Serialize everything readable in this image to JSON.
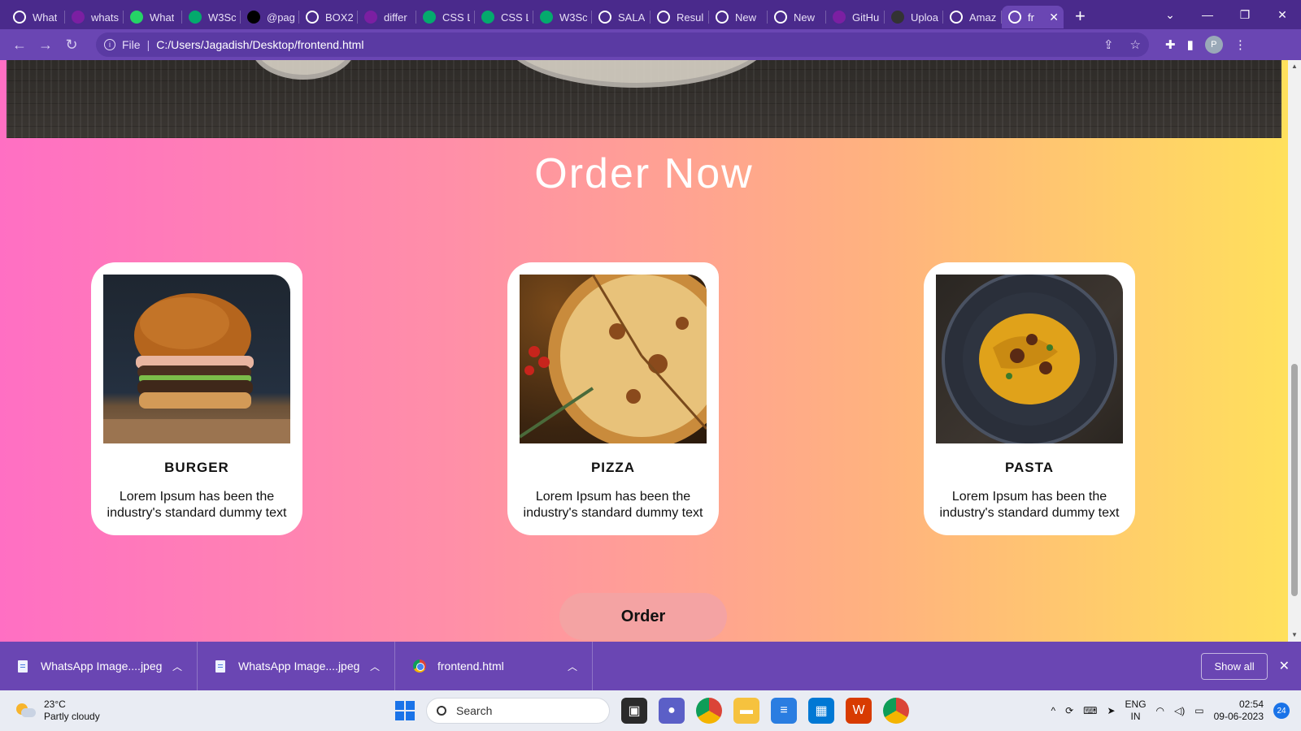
{
  "browser": {
    "tabs": [
      {
        "label": "What",
        "icon": "chrome-icon",
        "color": "#ffffff"
      },
      {
        "label": "whats",
        "icon": "yahoo-icon",
        "color": "#7b1fa2"
      },
      {
        "label": "What",
        "icon": "whatsapp-icon",
        "color": "#25d366"
      },
      {
        "label": "W3Sc",
        "icon": "w3schools-icon",
        "color": "#04aa6d"
      },
      {
        "label": "@pag",
        "icon": "medium-icon",
        "color": "#000000"
      },
      {
        "label": "BOX2",
        "icon": "chrome-icon",
        "color": "#ffffff"
      },
      {
        "label": "differ",
        "icon": "yahoo-icon",
        "color": "#7b1fa2"
      },
      {
        "label": "CSS L",
        "icon": "w3schools-icon",
        "color": "#04aa6d"
      },
      {
        "label": "CSS L",
        "icon": "w3schools-icon",
        "color": "#04aa6d"
      },
      {
        "label": "W3Sc",
        "icon": "w3schools-icon",
        "color": "#04aa6d"
      },
      {
        "label": "SALA",
        "icon": "chrome-icon",
        "color": "#ffffff"
      },
      {
        "label": "Resul",
        "icon": "chrome-icon",
        "color": "#ffffff"
      },
      {
        "label": "New",
        "icon": "chrome-icon",
        "color": "#ffffff"
      },
      {
        "label": "New",
        "icon": "chrome-icon",
        "color": "#ffffff"
      },
      {
        "label": "GitHu",
        "icon": "yahoo-icon",
        "color": "#7b1fa2"
      },
      {
        "label": "Uploa",
        "icon": "github-icon",
        "color": "#333333"
      },
      {
        "label": "Amaz",
        "icon": "amazon-icon",
        "color": "#ffffff"
      },
      {
        "label": "fr",
        "icon": "chrome-icon",
        "color": "#ffffff",
        "active": true
      }
    ],
    "address": {
      "scheme": "File",
      "url": "C:/Users/Jagadish/Desktop/frontend.html"
    },
    "profile_initial": "P"
  },
  "page": {
    "section_title": "Order Now",
    "cards": [
      {
        "name": "BURGER",
        "description": "Lorem Ipsum has been the industry's standard dummy text"
      },
      {
        "name": "PIZZA",
        "description": "Lorem Ipsum has been the industry's standard dummy text"
      },
      {
        "name": "PASTA",
        "description": "Lorem Ipsum has been the industry's standard dummy text"
      }
    ],
    "order_button": "Order",
    "colors": {
      "gradient_start": "#ff6fc3",
      "gradient_end": "#ffe05c",
      "button_bg": "#f4a3a3"
    }
  },
  "downloads": {
    "items": [
      {
        "name": "WhatsApp Image....jpeg",
        "icon": "file-icon"
      },
      {
        "name": "WhatsApp Image....jpeg",
        "icon": "file-icon"
      },
      {
        "name": "frontend.html",
        "icon": "chrome-icon"
      }
    ],
    "show_all": "Show all"
  },
  "taskbar": {
    "weather": {
      "temp": "23°C",
      "condition": "Partly cloudy"
    },
    "search_label": "Search",
    "lang": {
      "line1": "ENG",
      "line2": "IN"
    },
    "clock": {
      "time": "02:54",
      "date": "09-06-2023"
    },
    "notification_count": "24"
  }
}
